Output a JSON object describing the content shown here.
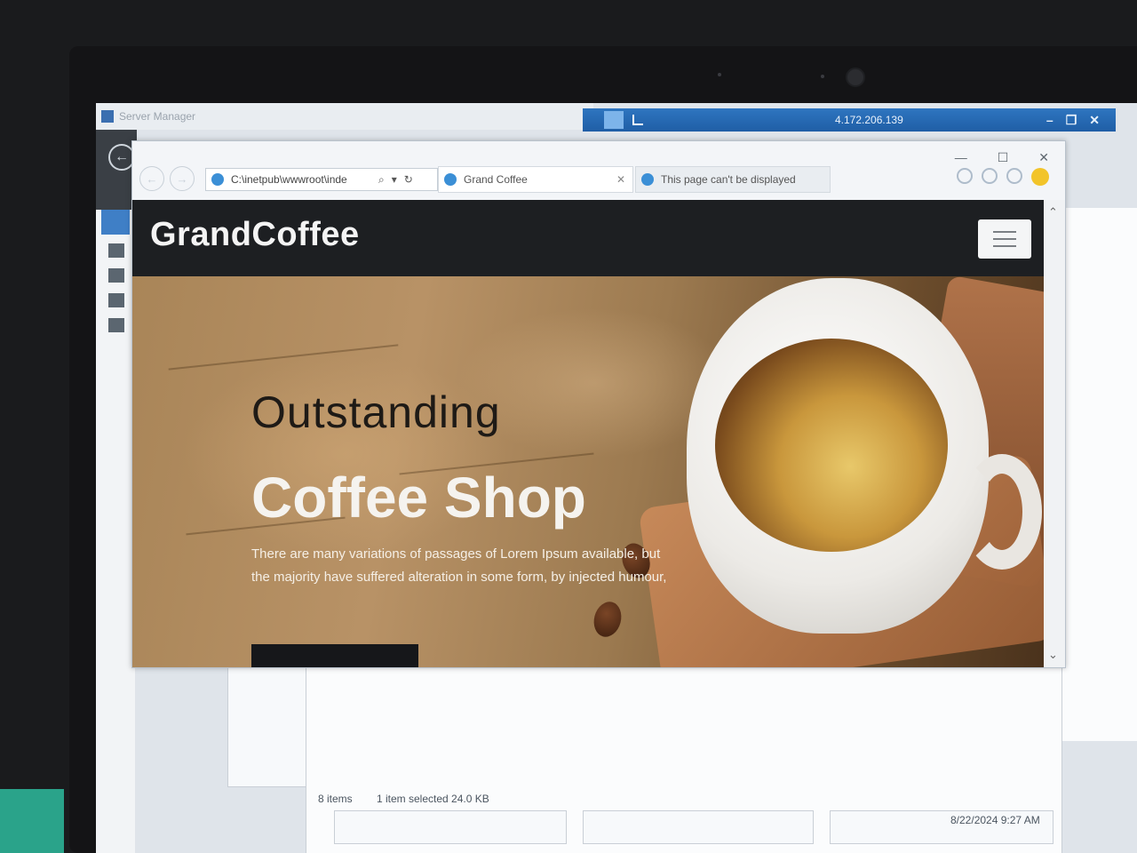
{
  "server_manager": {
    "title": "Server Manager"
  },
  "rdp": {
    "ip": "4.172.206.139",
    "min": "–",
    "restore": "❐",
    "close": "✕"
  },
  "ie": {
    "window_controls": {
      "min": "—",
      "max": "☐",
      "close": "✕"
    },
    "nav": {
      "back": "←",
      "forward": "→"
    },
    "address": "C:\\inetpub\\wwwroot\\inde",
    "address_icons": {
      "search": "⌕",
      "dropdown": "▾",
      "refresh": "↻"
    },
    "tabs": [
      {
        "label": "Grand Coffee",
        "close": "✕"
      },
      {
        "label": "This page can't be displayed"
      }
    ],
    "scroll_up": "⌃",
    "scroll_down": "⌄"
  },
  "site": {
    "brand": "GrandCoffee",
    "hero": {
      "line1": "Outstanding",
      "line2": "Coffee Shop",
      "text": "There are many variations of passages of Lorem Ipsum available, but the majority have suffered alteration in some form, by injected humour,"
    }
  },
  "explorer": {
    "item_count": "8 items",
    "selection": "1 item selected  24.0 KB",
    "date": "8/22/2024 9:27 AM"
  },
  "colors": {
    "accent_blue": "#2e75c0",
    "nav_dark": "#1d1f22",
    "hero_text": "#f5f3ef"
  }
}
